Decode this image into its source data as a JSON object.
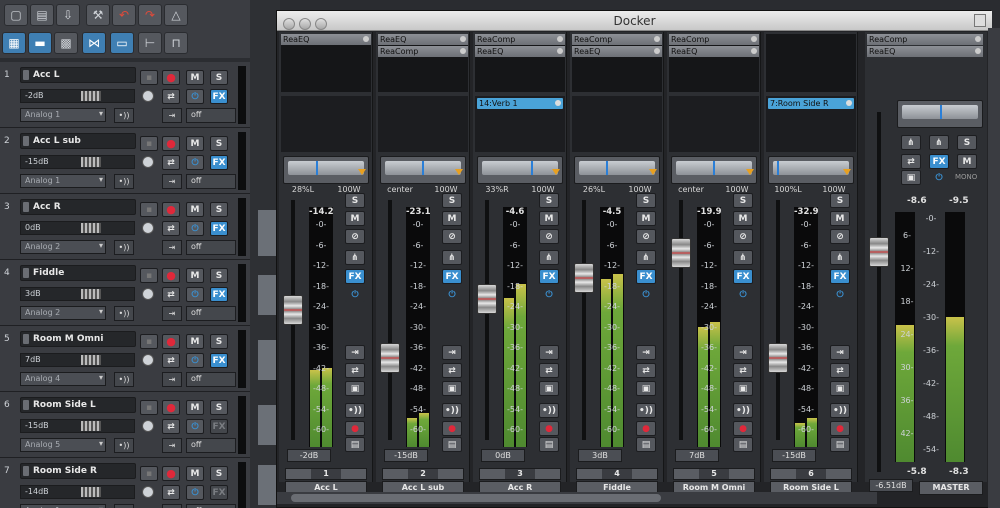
{
  "docker": {
    "title": "Docker"
  },
  "tracks": [
    {
      "num": "1",
      "name": "Acc L",
      "vol": "-2dB",
      "input": "Analog 1",
      "auto": "off",
      "fx_on": true
    },
    {
      "num": "2",
      "name": "Acc L sub",
      "vol": "-15dB",
      "input": "Analog 1",
      "auto": "off",
      "fx_on": true
    },
    {
      "num": "3",
      "name": "Acc R",
      "vol": "0dB",
      "input": "Analog 2",
      "auto": "off",
      "fx_on": true
    },
    {
      "num": "4",
      "name": "Fiddle",
      "vol": "3dB",
      "input": "Analog 2",
      "auto": "off",
      "fx_on": true
    },
    {
      "num": "5",
      "name": "Room M Omni",
      "vol": "7dB",
      "input": "Analog 4",
      "auto": "off",
      "fx_on": true
    },
    {
      "num": "6",
      "name": "Room Side L",
      "vol": "-15dB",
      "input": "Analog 5",
      "auto": "off",
      "fx_on": false
    },
    {
      "num": "7",
      "name": "Room Side R",
      "vol": "-14dB",
      "input": "Analog 1",
      "auto": "off",
      "fx_on": false
    }
  ],
  "mixer": [
    {
      "num": "1",
      "name": "Acc L",
      "fx": [
        "ReaEQ"
      ],
      "send": "",
      "pan": "28%L",
      "width": "100W",
      "peak": "-14.2",
      "vol": "-2dB",
      "meter_l": 0.32,
      "meter_r": 0.33,
      "fader": 0.55,
      "pan_pos": 0.38
    },
    {
      "num": "2",
      "name": "Acc L sub",
      "fx": [
        "ReaEQ",
        "ReaComp"
      ],
      "send": "",
      "pan": "center",
      "width": "100W",
      "peak": "-23.1",
      "vol": "-15dB",
      "meter_l": 0.12,
      "meter_r": 0.14,
      "fader": 0.32,
      "pan_pos": 0.5
    },
    {
      "num": "3",
      "name": "Acc R",
      "fx": [
        "ReaComp",
        "ReaEQ"
      ],
      "send": "14:Verb 1",
      "pan": "33%R",
      "width": "100W",
      "peak": "-4.6",
      "vol": "0dB",
      "meter_l": 0.62,
      "meter_r": 0.68,
      "fader": 0.6,
      "pan_pos": 0.66
    },
    {
      "num": "4",
      "name": "Fiddle",
      "fx": [
        "ReaComp",
        "ReaEQ"
      ],
      "send": "",
      "pan": "26%L",
      "width": "100W",
      "peak": "-4.5",
      "vol": "3dB",
      "meter_l": 0.7,
      "meter_r": 0.72,
      "fader": 0.7,
      "pan_pos": 0.37
    },
    {
      "num": "5",
      "name": "Room M Omni",
      "fx": [
        "ReaComp",
        "ReaEQ"
      ],
      "send": "",
      "pan": "center",
      "width": "100W",
      "peak": "-19.9",
      "vol": "7dB",
      "meter_l": 0.5,
      "meter_r": 0.52,
      "fader": 0.82,
      "pan_pos": 0.5
    },
    {
      "num": "6",
      "name": "Room Side L",
      "fx": [],
      "send": "7:Room Side R",
      "pan": "100%L",
      "width": "100W",
      "peak": "-32.9",
      "vol": "-15dB",
      "meter_l": 0.1,
      "meter_r": 0.12,
      "fader": 0.32,
      "pan_pos": 0.05
    }
  ],
  "master": {
    "fx": [
      "ReaComp",
      "ReaEQ"
    ],
    "peak_l": "-8.6",
    "peak_r": "-9.5",
    "bottom_l": "-5.8",
    "bottom_r": "-8.3",
    "vol": "-6.51dB",
    "name": "MASTER",
    "mono": "MONO",
    "meter_l": 0.55,
    "meter_r": 0.58,
    "fader": 0.75
  },
  "meter_scale": [
    "-0-",
    "-6-",
    "-12-",
    "-18-",
    "-24-",
    "-30-",
    "-36-",
    "-42-",
    "-48-",
    "-54-",
    "-60-"
  ],
  "master_scale": [
    "-0-",
    "6-",
    "-12-",
    "12-",
    "-24-",
    "18-",
    "-30-",
    "24-",
    "-36-",
    "30-",
    "-42-",
    "36-",
    "-48-",
    "42-",
    "-54-"
  ],
  "strip_buttons": {
    "solo": "S",
    "mute": "M",
    "fx": "FX"
  },
  "colors": {
    "accent": "#3a8fcf",
    "meter_green": "#4f8a30",
    "meter_yellow": "#c9c24a",
    "record": "#e0283a"
  }
}
